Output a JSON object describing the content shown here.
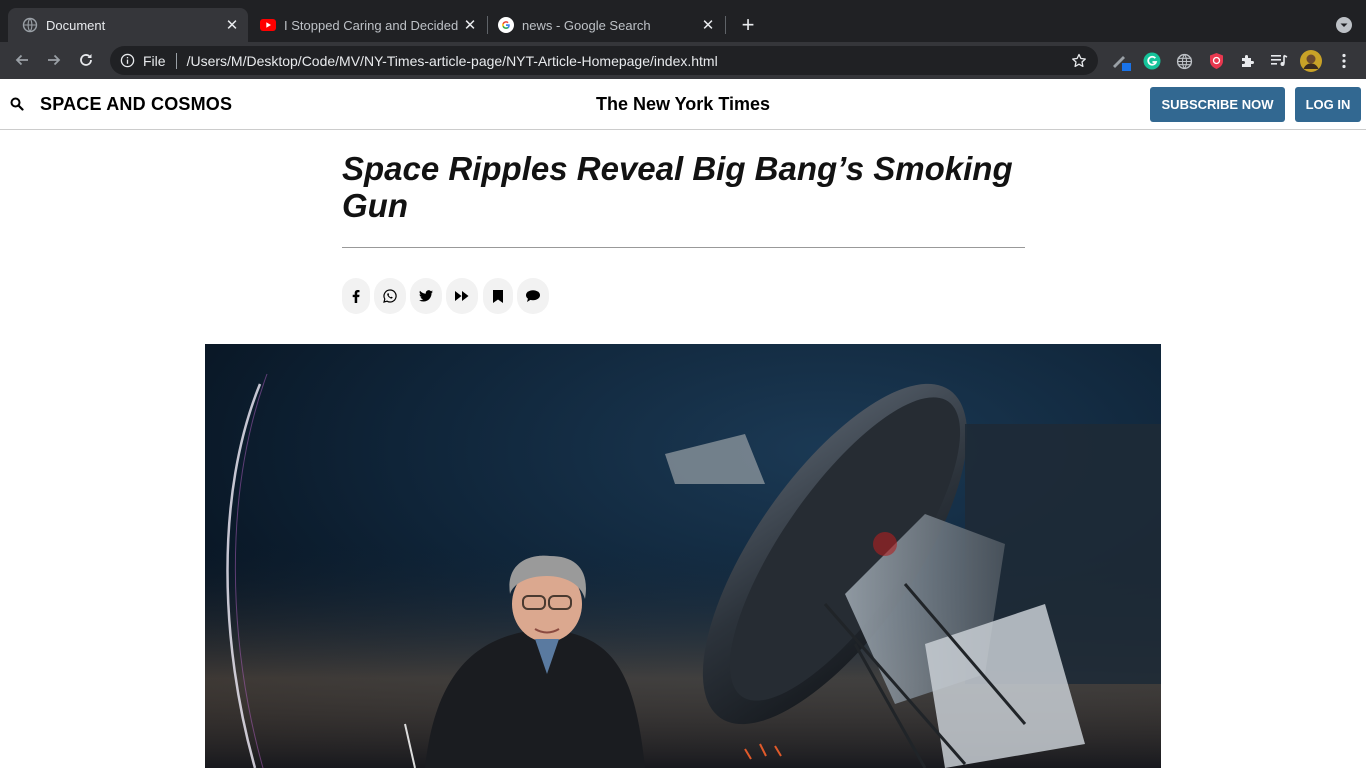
{
  "browser": {
    "tabs": [
      {
        "title": "Document",
        "favicon": "globe-icon",
        "active": true
      },
      {
        "title": "I Stopped Caring and Decided to",
        "favicon": "youtube-icon",
        "active": false
      },
      {
        "title": "news - Google Search",
        "favicon": "google-icon",
        "active": false
      }
    ],
    "omnibox": {
      "scheme": "File",
      "url": "/Users/M/Desktop/Code/MV/NY-Times-article-page/NYT-Article-Homepage/index.html"
    },
    "extensions": [
      "pen-extension-icon",
      "grammarly-icon",
      "globe-extension-icon",
      "shield-extension-icon",
      "puzzle-icon",
      "media-queue-icon",
      "profile-avatar"
    ]
  },
  "header": {
    "section": "SPACE AND COSMOS",
    "masthead": "The New York Times",
    "subscribe_label": "SUBSCRIBE NOW",
    "login_label": "LOG IN"
  },
  "article": {
    "headline": "Space Ripples Reveal Big Bang’s Smoking Gun",
    "share_buttons": [
      "facebook-icon",
      "whatsapp-icon",
      "twitter-icon",
      "forward-icon",
      "bookmark-icon",
      "comment-icon"
    ],
    "hero_image": "astronomer-with-telescope-photo"
  },
  "colors": {
    "tab_strip": "#202124",
    "toolbar": "#35363a",
    "button_blue": "#326891"
  }
}
